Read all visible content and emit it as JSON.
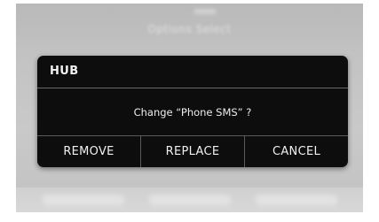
{
  "background": {
    "blurred_label": "Options Select"
  },
  "dialog": {
    "title": "HUB",
    "message": "Change “Phone SMS” ?",
    "buttons": {
      "remove": "REMOVE",
      "replace": "REPLACE",
      "cancel": "CANCEL"
    }
  },
  "colors": {
    "dialog_bg": "#0d0d0d",
    "text": "#f0f0f0",
    "divider": "#5a5a5a",
    "screen_bg": "#c4c4c4"
  }
}
